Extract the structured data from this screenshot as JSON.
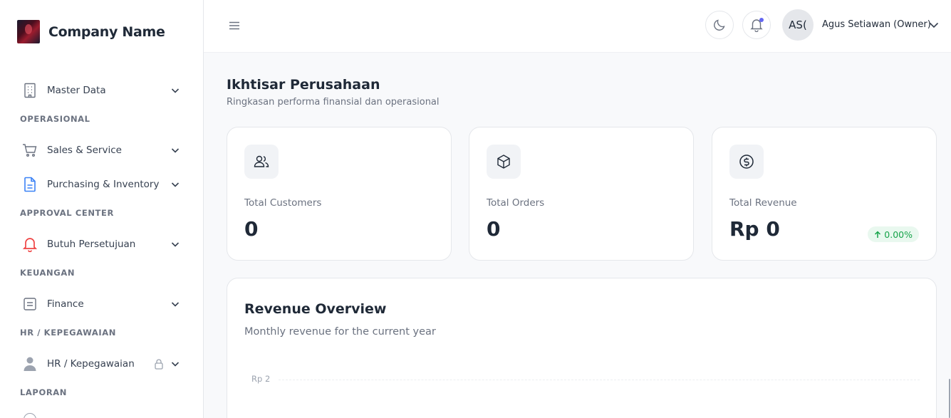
{
  "brand": {
    "name": "Company Name"
  },
  "sidebar": {
    "items": [
      {
        "label": "Master Data"
      },
      {
        "label": "Sales & Service"
      },
      {
        "label": "Purchasing & Inventory"
      },
      {
        "label": "Butuh Persetujuan"
      },
      {
        "label": "Finance"
      },
      {
        "label": "HR / Kepegawaian"
      }
    ],
    "sections": [
      "OPERASIONAL",
      "APPROVAL CENTER",
      "KEUANGAN",
      "HR / KEPEGAWAIAN",
      "LAPORAN"
    ]
  },
  "topbar": {
    "avatar_initials": "AS(",
    "user_name": "Agus Setiawan (Owner)"
  },
  "page": {
    "title": "Ikhtisar Perusahaan",
    "subtitle": "Ringkasan performa finansial dan operasional"
  },
  "stats": [
    {
      "label": "Total Customers",
      "value": "0",
      "icon": "users-icon"
    },
    {
      "label": "Total Orders",
      "value": "0",
      "icon": "box-icon"
    },
    {
      "label": "Total Revenue",
      "value": "Rp 0",
      "icon": "dollar-circle-icon",
      "change": "0.00%"
    }
  ],
  "chart": {
    "title": "Revenue Overview",
    "subtitle": "Monthly revenue for the current year",
    "tick_label": "Rp 2"
  },
  "colors": {
    "accent": "#6366f1",
    "danger": "#ef4444",
    "info": "#3b82f6",
    "success": "#16a34a"
  }
}
